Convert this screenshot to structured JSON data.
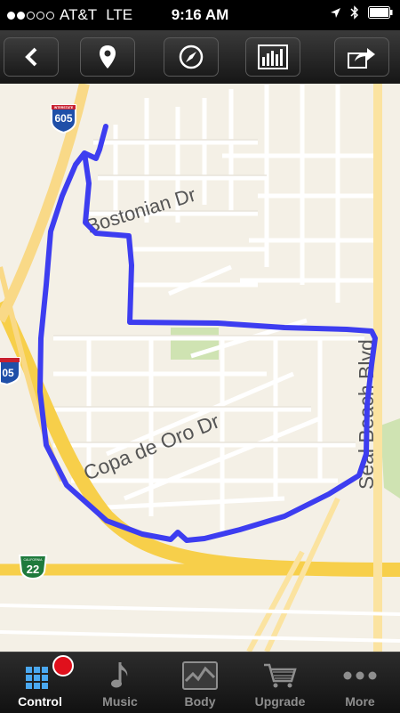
{
  "status": {
    "carrier": "AT&T",
    "network": "LTE",
    "time": "9:16 AM"
  },
  "toolbar": {
    "back_icon": "back-arrow-icon",
    "pin_icon": "location-pin-icon",
    "compass_icon": "compass-icon",
    "chart_icon": "bar-chart-icon",
    "share_icon": "share-icon"
  },
  "map": {
    "labels": {
      "street1": "Bostonian Dr",
      "street2": "Copa de Oro Dr",
      "street3": "Seal Beach Blvd"
    },
    "shields": {
      "interstate_top": "605",
      "interstate_left": "05",
      "state_route": "22",
      "interstate_word": "INTERSTATE",
      "state_word": "CALIFORNIA"
    },
    "route_color": "#3d3df0"
  },
  "tabs": [
    {
      "label": "Control",
      "icon": "grid-icon",
      "active": true
    },
    {
      "label": "Music",
      "icon": "music-note-icon"
    },
    {
      "label": "Body",
      "icon": "heart-graph-icon"
    },
    {
      "label": "Upgrade",
      "icon": "cart-icon"
    },
    {
      "label": "More",
      "icon": "more-dots-icon"
    }
  ]
}
